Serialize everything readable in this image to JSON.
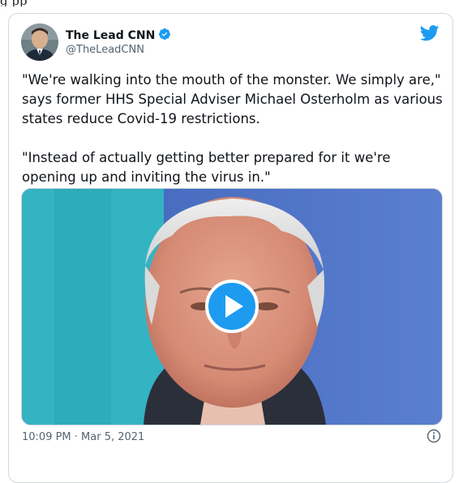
{
  "page_fragment": "g         pp",
  "author": {
    "display_name": "The Lead CNN",
    "handle": "@TheLeadCNN",
    "verified": true
  },
  "tweet": {
    "paragraph1": "\"We're walking into the mouth of the monster. We simply are,\" says former HHS Special Adviser Michael Osterholm as various states reduce Covid-19 restrictions.",
    "paragraph2": "\"Instead of actually getting better prepared for it we're opening up and inviting the virus in.\""
  },
  "media": {
    "type": "video",
    "play_icon": "play-icon"
  },
  "footer": {
    "timestamp": "10:09 PM · Mar 5, 2021",
    "info_icon": "info-icon"
  },
  "colors": {
    "accent": "#1d9bf0",
    "text": "#0f1419",
    "muted": "#536471",
    "border": "#cfd9de"
  }
}
